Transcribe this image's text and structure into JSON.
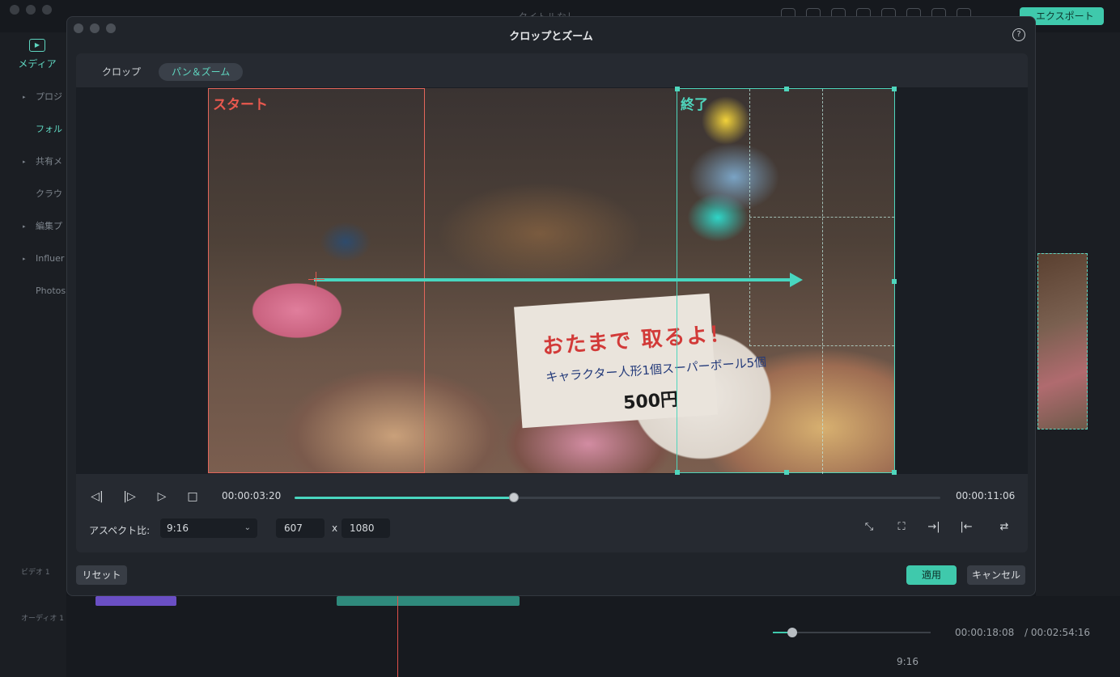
{
  "app": {
    "title": "タイトルなし",
    "export_label": "エクスポート",
    "media_label": "メディア",
    "nav_items": [
      {
        "label": "プロジ",
        "arrow": true
      },
      {
        "label": "フォル",
        "arrow": false,
        "active": true
      },
      {
        "label": "共有メ",
        "arrow": true
      },
      {
        "label": "クラウ",
        "arrow": false
      },
      {
        "label": "編集プ",
        "arrow": true
      },
      {
        "label": "Influer",
        "arrow": true
      },
      {
        "label": "Photos",
        "arrow": false
      }
    ],
    "track_video": "ビデオ 1",
    "track_audio": "オーディオ 1",
    "preview_time_current": "00:00:18:08",
    "preview_time_total": "/ 00:02:54:16",
    "preview_aspect": "9:16"
  },
  "dialog": {
    "title": "クロップとズーム",
    "help_symbol": "?",
    "tabs": [
      {
        "label": "クロップ",
        "active": false
      },
      {
        "label": "パン＆ズーム",
        "active": true
      }
    ],
    "start_label": "スタート",
    "end_label": "終了",
    "sign": {
      "line1": "おたまで 取るよ！",
      "line2": "キャラクター人形1個スーパーボール5個",
      "line3": "500円"
    },
    "player": {
      "current_time": "00:00:03:20",
      "total_time": "00:00:11:06",
      "progress": 0.34
    },
    "aspect_label": "アスペクト比:",
    "aspect_value": "9:16",
    "width": "607",
    "times_symbol": "x",
    "height": "1080",
    "reset_label": "リセット",
    "apply_label": "適用",
    "cancel_label": "キャンセル"
  },
  "colors": {
    "accent": "#3fc9ac",
    "start_frame": "#e8584e",
    "end_frame": "#4fd6bd"
  }
}
